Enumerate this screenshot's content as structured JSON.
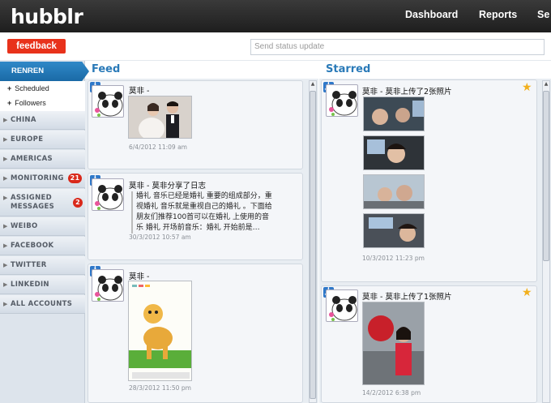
{
  "app": {
    "logo": "hubblr"
  },
  "nav": {
    "dashboard": "Dashboard",
    "reports": "Reports",
    "settings": "Se"
  },
  "toolbar": {
    "feedback": "feedback",
    "status_placeholder": "Send status update"
  },
  "sidebar": {
    "header": "RENREN",
    "sub_items": [
      {
        "label": "Scheduled"
      },
      {
        "label": "Followers"
      }
    ],
    "items": [
      {
        "label": "CHINA"
      },
      {
        "label": "EUROPE"
      },
      {
        "label": "AMERICAS"
      },
      {
        "label": "MONITORING",
        "badge": "21"
      },
      {
        "label": "ASSIGNED",
        "label2": "MESSAGES",
        "badge": "2"
      },
      {
        "label": "WEIBO"
      },
      {
        "label": "FACEBOOK"
      },
      {
        "label": "TWITTER"
      },
      {
        "label": "LINKEDIN"
      },
      {
        "label": "ALL ACCOUNTS"
      }
    ]
  },
  "feed": {
    "title": "Feed",
    "posts": [
      {
        "user": "莫非 -",
        "time": "6/4/2012 11:09 am"
      },
      {
        "user": "莫非 - 莫非分享了日志",
        "text": [
          "婚礼 音乐已经是婚礼 重要的组成部分，重",
          "视婚礼 音乐就是重视自己的婚礼 。下面给",
          "朋友们推荐100首可以在婚礼 上使用的音",
          "乐 婚礼 开场前音乐：婚礼 开始前是…"
        ],
        "time": "30/3/2012 10:57 am"
      },
      {
        "user": "莫非 -",
        "time": "28/3/2012 11:50 pm"
      }
    ]
  },
  "starred": {
    "title": "Starred",
    "posts": [
      {
        "user": "莫非 - 莫非上传了2张照片",
        "time": "10/3/2012 11:23 pm"
      },
      {
        "user": "莫非 - 莫非上传了1张照片",
        "time": "14/2/2012 6:38 pm"
      }
    ]
  },
  "icons": {
    "renren": "renren-icon",
    "star": "star-icon"
  },
  "colors": {
    "accent": "#2a7ab8",
    "feedback": "#e8321b",
    "badge": "#d9291b",
    "star": "#f2b01e"
  }
}
